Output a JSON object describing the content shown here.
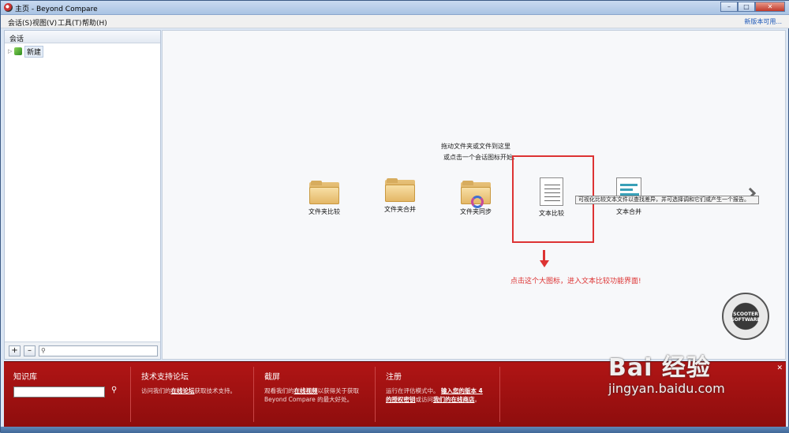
{
  "window": {
    "title": "主页 - Beyond Compare",
    "min": "–",
    "max": "□",
    "close": "✕"
  },
  "menu": {
    "items": [
      "会话(S)",
      "视图(V)",
      "工具(T)",
      "帮助(H)"
    ],
    "new_version": "新版本可用..."
  },
  "sidebar": {
    "header": "会话",
    "tree_item": "新建",
    "add_btn": "+",
    "remove_btn": "–",
    "search_placeholder": ""
  },
  "main": {
    "hint_line1": "拖动文件夹或文件到这里",
    "hint_line2": "或点击一个会话图标开始:",
    "tiles": [
      "文件夹比较",
      "文件夹合并",
      "文件夹同步",
      "文本比较",
      "文本合并"
    ],
    "tooltip": "可视化比较文本文件以查找差异，并可选择调和它们或产生一个报告。",
    "annotation": "点击这个大图标，进入文本比较功能界面!",
    "stamp_text": "SCOOTER SOFTWARE"
  },
  "bottom": {
    "kb_title": "知识库",
    "forum_title": "技术支持论坛",
    "forum_text_pre": "访问我们的",
    "forum_link": "在线论坛",
    "forum_text_post": "获取技术支持。",
    "tour_title": "截屏",
    "tour_text_pre": "观看我们的",
    "tour_link": "在线视频",
    "tour_text_post": "以获得关于获取",
    "tour_text_line2": "Beyond Compare 的最大好处。",
    "reg_title": "注册",
    "reg_text_pre": "运行在评估模式中。",
    "reg_link1": "输入您的版本 4",
    "reg_link2": "的授权密钥",
    "reg_text_mid": "或访问",
    "reg_link3": "我们的在线商店",
    "reg_text_end": "。",
    "close": "✕"
  },
  "watermark": {
    "brand": "Bai 经验",
    "url": "jingyan.baidu.com"
  }
}
